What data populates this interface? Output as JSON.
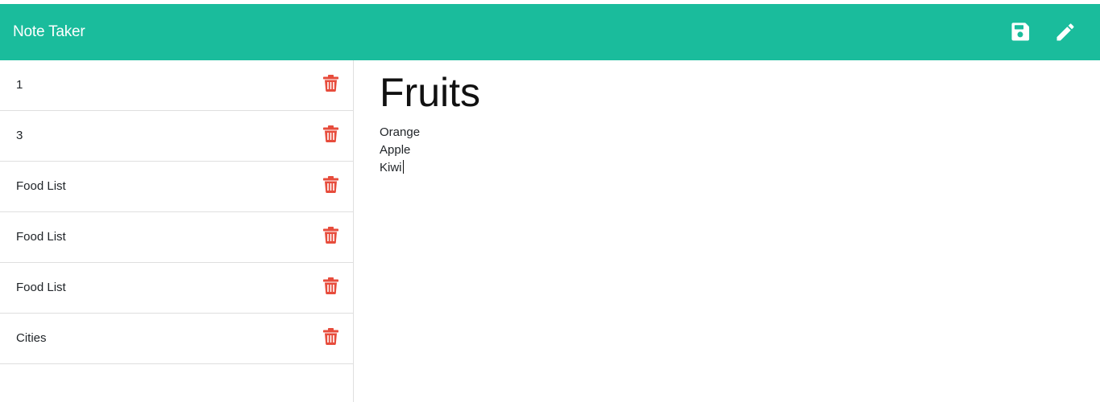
{
  "navbar": {
    "brand": "Note Taker",
    "icons": {
      "save": "save-icon",
      "new": "pencil-icon"
    },
    "color": "#1abc9c"
  },
  "sidebar": {
    "notes": [
      {
        "title": "1"
      },
      {
        "title": "3"
      },
      {
        "title": "Food List"
      },
      {
        "title": "Food List"
      },
      {
        "title": "Food List"
      },
      {
        "title": "Cities"
      }
    ],
    "delete_icon": "trash-icon",
    "delete_color": "#e74c3c"
  },
  "editor": {
    "title": "Fruits",
    "body_lines": [
      "Orange",
      "Apple",
      "Kiwi"
    ]
  }
}
